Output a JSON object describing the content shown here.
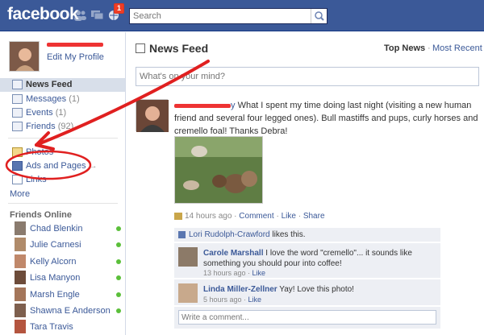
{
  "topbar": {
    "logo": "facebook",
    "notification_count": "1",
    "search_placeholder": "Search"
  },
  "sidebar": {
    "edit_profile": "Edit My Profile",
    "nav": [
      {
        "label": "News Feed",
        "count": ""
      },
      {
        "label": "Messages",
        "count": "(1)"
      },
      {
        "label": "Events",
        "count": "(1)"
      },
      {
        "label": "Friends",
        "count": "(92)"
      },
      {
        "label": "Photos",
        "count": ""
      },
      {
        "label": "Ads and Pages",
        "count": ""
      },
      {
        "label": "Links",
        "count": ""
      }
    ],
    "more": "More",
    "friends_online_title": "Friends Online",
    "friends": [
      "Chad Blenkin",
      "Julie Carnesi",
      "Kelly Alcorn",
      "Lisa Manyon",
      "Marsh Engle",
      "Shawna E Anderson",
      "Tara Travis"
    ]
  },
  "main": {
    "title": "News Feed",
    "top_news": "Top News",
    "dot": "·",
    "most_recent": "Most Recent",
    "status_placeholder": "What's on your mind?",
    "story": {
      "name_suffix": "y",
      "text": "What I spent my time doing last night (visiting a new human friend and several four legged ones). Bull mastiffs and pups, curly horses and cremello foal! Thanks Debra!",
      "time": "14 hours ago",
      "dot": "·",
      "comment_link": "Comment",
      "like_link": "Like",
      "share_link": "Share",
      "likes_name": "Lori Rudolph-Crawford",
      "likes_suffix": "likes this."
    },
    "comments": [
      {
        "name": "Carole Marshall",
        "text": "I love the word \"cremello\"... it sounds like something you should pour into coffee!",
        "time": "13 hours ago",
        "like": "Like"
      },
      {
        "name": "Linda Miller-Zellner",
        "text": "Yay! Love this photo!",
        "time": "5 hours ago",
        "like": "Like"
      }
    ],
    "write_comment_placeholder": "Write a comment..."
  },
  "colors": {
    "brand": "#3b5998",
    "annotation": "#e02020"
  }
}
